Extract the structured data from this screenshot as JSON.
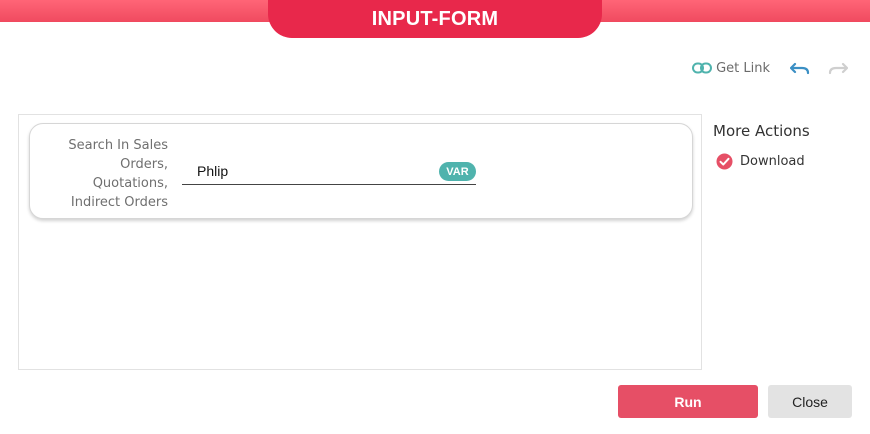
{
  "header": {
    "title": "INPUT-FORM"
  },
  "toolbar": {
    "get_link_label": "Get Link",
    "icons": {
      "link": "link-icon",
      "undo": "undo-icon",
      "redo": "redo-icon"
    }
  },
  "form": {
    "field_label": "Search In Sales Orders, Quotations, Indirect Orders",
    "field_value": "Phlip",
    "badge": "VAR"
  },
  "more_actions": {
    "title": "More Actions",
    "download_label": "Download"
  },
  "buttons": {
    "run": "Run",
    "close": "Close"
  },
  "colors": {
    "brand": "#e8284b",
    "accent_teal": "#4fb3ad",
    "run_button": "#e64f66",
    "close_button": "#e3e3e3"
  }
}
